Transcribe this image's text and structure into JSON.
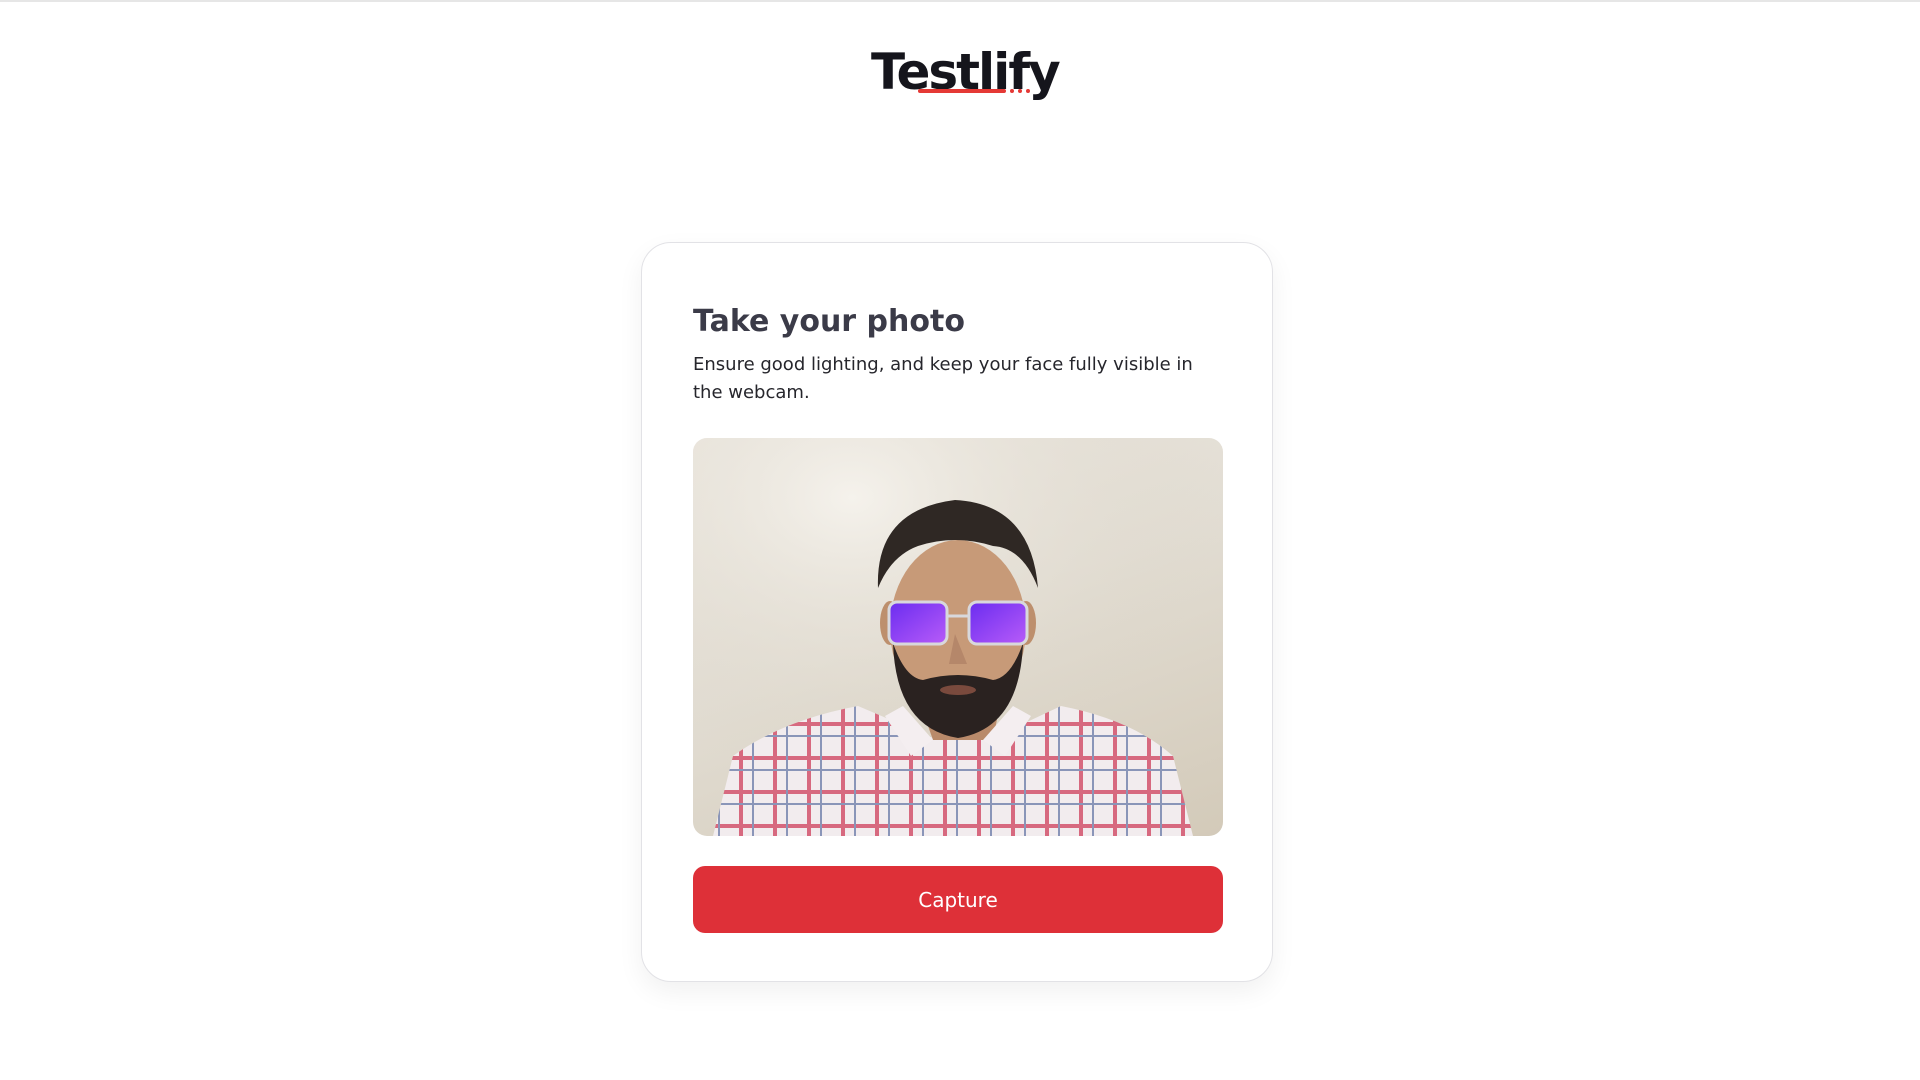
{
  "brand": {
    "name": "Testlify",
    "accent_color": "#e53935"
  },
  "card": {
    "title": "Take your photo",
    "subtitle": "Ensure good lighting, and keep your face fully visible in the webcam."
  },
  "webcam": {
    "icon": "webcam-preview-image"
  },
  "actions": {
    "capture_label": "Capture",
    "capture_color": "#de3038"
  }
}
